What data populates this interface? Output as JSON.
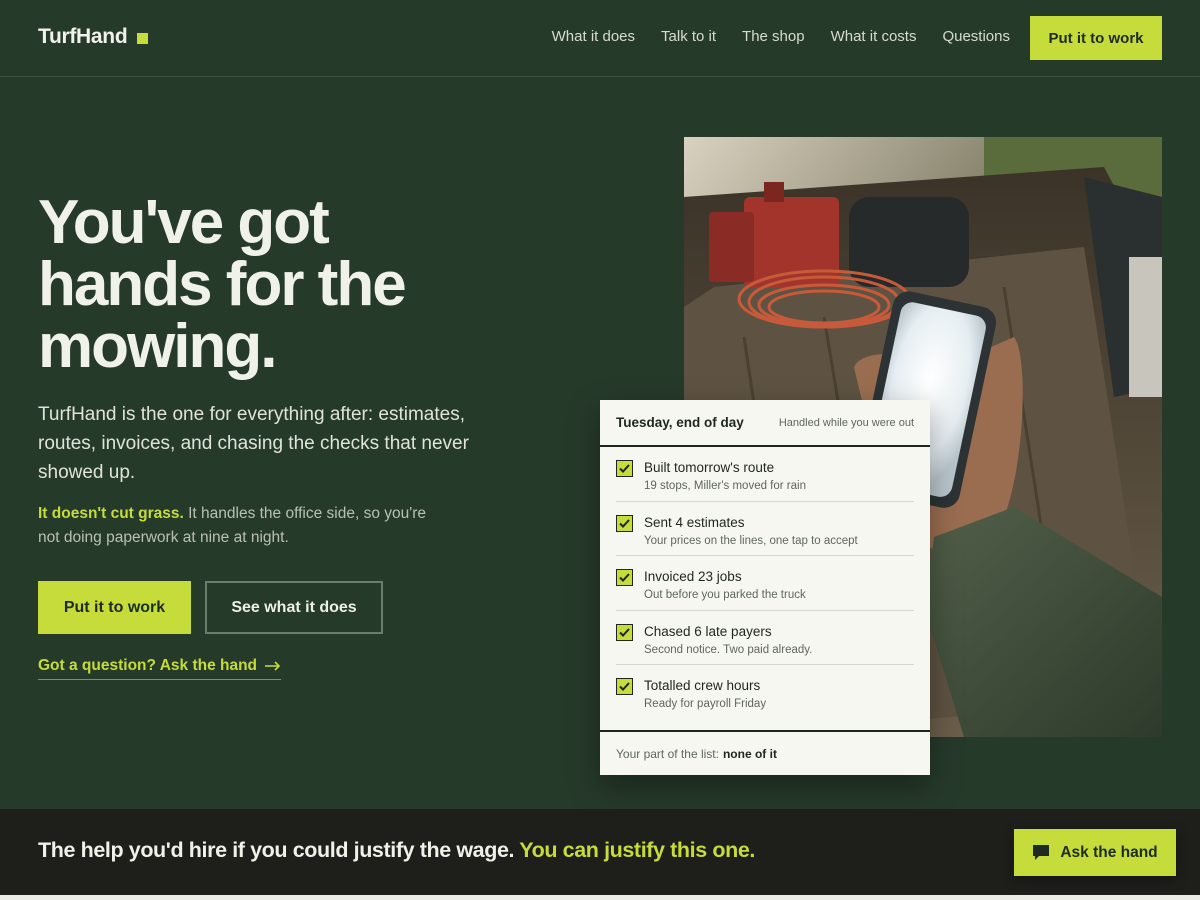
{
  "brand": {
    "name": "TurfHand",
    "accent": "#c5dc3a",
    "background": "#263a2a"
  },
  "nav": {
    "items": [
      "What it does",
      "Talk to it",
      "The shop",
      "What it costs",
      "Questions"
    ],
    "cta": "Put it to work"
  },
  "hero": {
    "title": "You've got hands for the mowing.",
    "subtitle": "TurfHand is the one for everything after: estimates, routes, invoices, and chasing the checks that never showed up.",
    "note_accent": "It doesn't cut grass.",
    "note_rest": "It handles the office side, so you're not doing paperwork at nine at night.",
    "primary_button": "Put it to work",
    "secondary_button": "See what it does",
    "question_link": "Got a question? Ask the hand",
    "arrow_icon": "arrow-right-icon"
  },
  "card": {
    "day": "Tuesday, end of day",
    "subtitle": "Handled while you were out",
    "tasks": [
      {
        "title": "Built tomorrow's route",
        "desc": "19 stops, Miller's moved for rain"
      },
      {
        "title": "Sent 4 estimates",
        "desc": "Your prices on the lines, one tap to accept"
      },
      {
        "title": "Invoiced 23 jobs",
        "desc": "Out before you parked the truck"
      },
      {
        "title": "Chased 6 late payers",
        "desc": "Second notice. Two paid already."
      },
      {
        "title": "Totalled crew hours",
        "desc": "Ready for payroll Friday"
      }
    ],
    "footer_label": "Your part of the list:",
    "footer_value": "none of it"
  },
  "band": {
    "text": "The help you'd hire if you could justify the wage.",
    "accent": "You can justify this one."
  },
  "chat": {
    "label": "Ask the hand",
    "icon": "chat-bubble-icon"
  }
}
